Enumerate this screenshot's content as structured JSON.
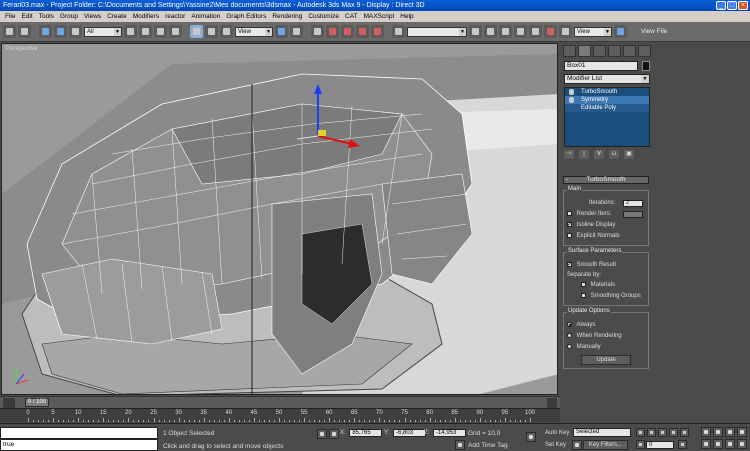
{
  "window": {
    "title": "Ferari03.max    - Project Folder: C:\\Documents and Settings\\Yassine2\\Mes documents\\3dsmax     - Autodesk 3ds Max 9       - Display : Direct 3D",
    "minimize": "_",
    "maximize": "□",
    "close": "×"
  },
  "menu": [
    "File",
    "Edit",
    "Tools",
    "Group",
    "Views",
    "Create",
    "Modifiers",
    "reactor",
    "Animation",
    "Graph Editors",
    "Rendering",
    "Customize",
    "CAT",
    "MAXScript",
    "Help"
  ],
  "toolbar": {
    "selection_filter": "All",
    "reference_coord": "View",
    "named_selection": "",
    "render_preset": "View",
    "view_file": "View File"
  },
  "viewport": {
    "label": "Perspective"
  },
  "command_panel": {
    "object_name": "Box01",
    "object_color": "#111111",
    "modifier_list": "Modifier List",
    "stack": [
      {
        "label": "TurboSmooth",
        "state": "active"
      },
      {
        "label": "Symmetry",
        "state": "selected"
      },
      {
        "label": "Editable Poly",
        "state": "base"
      }
    ],
    "rollout_title": "TurboSmooth",
    "main_group": "Main",
    "iterations_label": "Iterations:",
    "iterations_value": "2",
    "render_iters_label": "Render Iters:",
    "render_iters_value": "",
    "isoline_label": "Isoline Display",
    "explicit_normals_label": "Explicit Normals",
    "surface_group": "Surface Parameters",
    "smooth_result_label": "Smooth Result",
    "separate_by_label": "Separate by:",
    "materials_label": "Materials",
    "smoothing_groups_label": "Smoothing Groups",
    "update_group": "Update Options",
    "always_label": "Always",
    "when_rendering_label": "When Rendering",
    "manually_label": "Manually",
    "update_button": "Update",
    "checks": {
      "render_iters": false,
      "isoline": true,
      "explicit_normals": false,
      "smooth_result": true,
      "materials": false,
      "smoothing_groups": false
    },
    "update_mode": "Always"
  },
  "timeline": {
    "frame_display": "0 / 100",
    "ticks": [
      0,
      5,
      10,
      15,
      20,
      25,
      30,
      35,
      40,
      45,
      50,
      55,
      60,
      65,
      70,
      75,
      80,
      85,
      90,
      95,
      100
    ]
  },
  "status": {
    "maxscript_output": "",
    "maxscript_input": "true",
    "selection": "1 Object Selected",
    "prompt": "Click and drag to select and move objects",
    "x_label": "X:",
    "x_value": "85,765",
    "y_label": "Y:",
    "y_value": "-6,803",
    "z_label": "Z:",
    "z_value": "-14,953",
    "grid": "Grid = 10,0",
    "add_time_tag": "Add Time Tag",
    "auto_key": "Auto Key",
    "auto_key_mode": "Selected",
    "set_key": "Set Key",
    "key_filters": "Key Filters...",
    "current_frame": "0"
  }
}
